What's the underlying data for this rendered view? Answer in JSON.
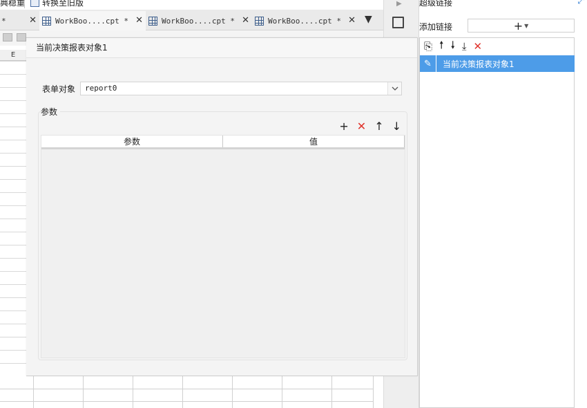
{
  "top_strip": {
    "left_text": "典稳重",
    "convert_label": "转换至旧版"
  },
  "tabs": [
    {
      "label": "*",
      "active": false
    },
    {
      "label": "WorkBoo....cpt *",
      "active": true
    },
    {
      "label": "WorkBoo....cpt *",
      "active": false
    },
    {
      "label": "WorkBoo....cpt *",
      "active": false
    }
  ],
  "sheet": {
    "col_label": "E"
  },
  "dialog": {
    "title": "当前决策报表对象1",
    "form_label": "表单对象",
    "form_value": "report0",
    "params_legend": "参数",
    "table_headers": [
      "参数",
      "值"
    ]
  },
  "hyperlink_panel": {
    "title": "超级链接",
    "add_link_label": "添加链接",
    "add_button_symbol": "+",
    "items": [
      {
        "label": "当前决策报表对象1",
        "selected": true
      }
    ]
  },
  "icons": {
    "add": "plus-icon",
    "delete": "delete-icon",
    "up": "arrow-up-icon",
    "down": "arrow-down-icon",
    "copy": "copy-icon",
    "move_bottom": "move-bottom-icon",
    "edit": "pencil-icon"
  },
  "colors": {
    "selection": "#4d9ce8",
    "delete_red": "#e0322b",
    "link_blue": "#2b7bd3"
  }
}
